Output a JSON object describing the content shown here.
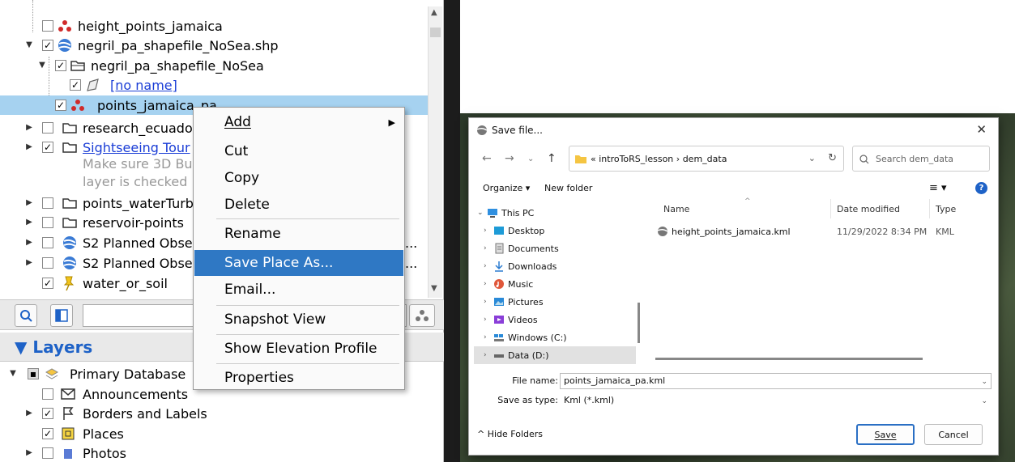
{
  "places_tree": {
    "items": [
      {
        "label": "height_points_jamaica"
      },
      {
        "label": "negril_pa_shapefile_NoSea.shp"
      },
      {
        "label": "negril_pa_shapefile_NoSea"
      },
      {
        "label": "[no name]"
      },
      {
        "label": "points_jamaica_pa"
      },
      {
        "label": "research_ecuado"
      },
      {
        "label": "Sightseeing Tour"
      },
      {
        "label": "Make sure 3D Bui"
      },
      {
        "label": "layer is checked"
      },
      {
        "label": "points_waterTurb"
      },
      {
        "label": "reservoir-points"
      },
      {
        "label": "S2 Planned Obse"
      },
      {
        "label": "S2 Planned Obse"
      },
      {
        "label": "water_or_soil"
      }
    ],
    "ellipsis": "..."
  },
  "context_menu": {
    "items": [
      "Add",
      "Cut",
      "Copy",
      "Delete",
      "Rename",
      "Save Place As...",
      "Email...",
      "Snapshot View",
      "Show Elevation Profile",
      "Properties"
    ],
    "highlighted": "Save Place As..."
  },
  "layers_panel": {
    "title": "Layers",
    "items": [
      {
        "label": "Primary Database"
      },
      {
        "label": "Announcements"
      },
      {
        "label": "Borders and Labels"
      },
      {
        "label": "Places"
      },
      {
        "label": "Photos"
      }
    ]
  },
  "save_dialog": {
    "title": "Save file...",
    "breadcrumb_prefix": "«",
    "breadcrumb": [
      "introToRS_lesson",
      "dem_data"
    ],
    "search_placeholder": "Search dem_data",
    "organize_label": "Organize",
    "new_folder_label": "New folder",
    "nav_items": [
      "This PC",
      "Desktop",
      "Documents",
      "Downloads",
      "Music",
      "Pictures",
      "Videos",
      "Windows (C:)",
      "Data (D:)"
    ],
    "columns": [
      "Name",
      "Date modified",
      "Type"
    ],
    "files": [
      {
        "name": "height_points_jamaica.kml",
        "date": "11/29/2022 8:34 PM",
        "type": "KML"
      }
    ],
    "file_name_label": "File name:",
    "file_name_value": "points_jamaica_pa.kml",
    "save_as_type_label": "Save as type:",
    "save_as_type_value": "Kml (*.kml)",
    "hide_folders_label": "Hide Folders",
    "save_button": "Save",
    "cancel_button": "Cancel"
  },
  "colors": {
    "selection": "#a6d2f0",
    "menu_highlight": "#2f78c4",
    "layers_title": "#1e62c7",
    "link": "#1a3dd6"
  }
}
